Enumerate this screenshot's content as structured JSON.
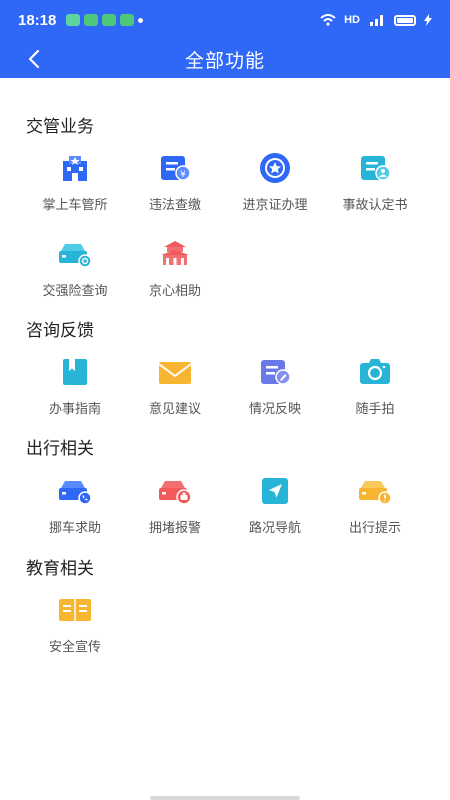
{
  "status_bar": {
    "time": "18:18",
    "network": "HD",
    "signal": "4G"
  },
  "header": {
    "title": "全部功能"
  },
  "sections": [
    {
      "title": "交管业务",
      "items": [
        {
          "label": "掌上车管所",
          "icon": "police-station-icon"
        },
        {
          "label": "违法查缴",
          "icon": "fine-payment-icon"
        },
        {
          "label": "进京证办理",
          "icon": "badge-star-icon"
        },
        {
          "label": "事故认定书",
          "icon": "accident-report-icon"
        },
        {
          "label": "交强险查询",
          "icon": "insurance-car-icon"
        },
        {
          "label": "京心相助",
          "icon": "tiananmen-icon"
        }
      ]
    },
    {
      "title": "咨询反馈",
      "items": [
        {
          "label": "办事指南",
          "icon": "guide-bookmark-icon"
        },
        {
          "label": "意见建议",
          "icon": "envelope-icon"
        },
        {
          "label": "情况反映",
          "icon": "edit-report-icon"
        },
        {
          "label": "随手拍",
          "icon": "camera-icon"
        }
      ]
    },
    {
      "title": "出行相关",
      "items": [
        {
          "label": "挪车求助",
          "icon": "move-car-icon"
        },
        {
          "label": "拥堵报警",
          "icon": "congestion-alarm-icon"
        },
        {
          "label": "路况导航",
          "icon": "navigation-icon"
        },
        {
          "label": "出行提示",
          "icon": "travel-tip-icon"
        }
      ]
    },
    {
      "title": "教育相关",
      "items": [
        {
          "label": "安全宣传",
          "icon": "open-book-icon"
        }
      ]
    }
  ],
  "colors": {
    "primary": "#2f67f6",
    "teal": "#27b4d7",
    "red": "#f05a5a",
    "orange": "#f8b531",
    "purple": "#6a78e8"
  }
}
